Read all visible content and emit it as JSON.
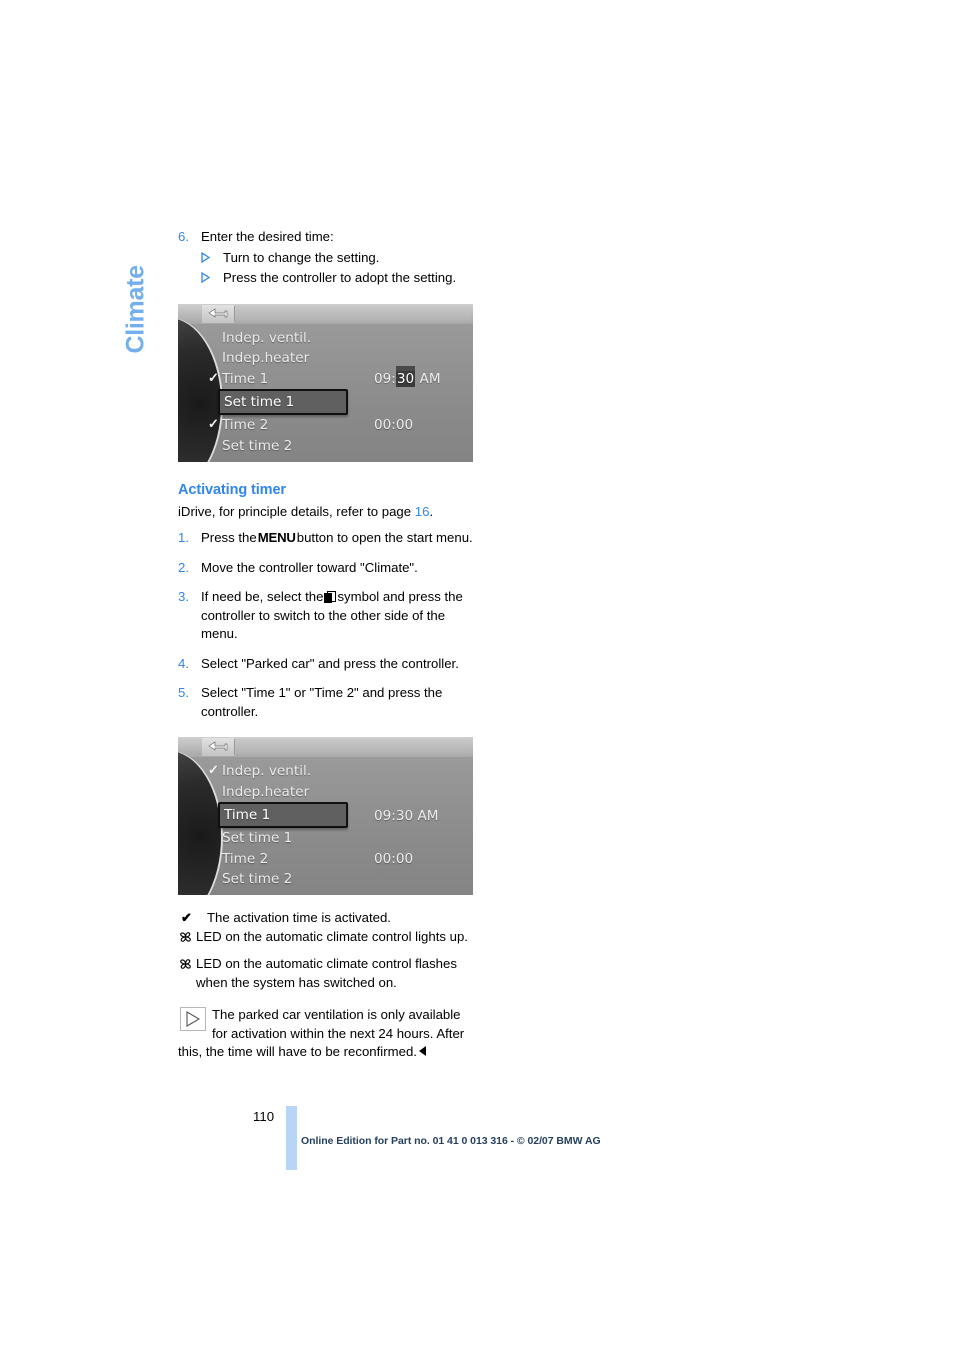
{
  "chapter_tab": {
    "label": "Climate"
  },
  "steps_top": {
    "number": "6.",
    "text": "Enter the desired time:",
    "substeps": [
      {
        "marker": "triangle-outline",
        "text": "Turn to change the setting."
      },
      {
        "marker": "triangle-outline",
        "text": "Press the controller to adopt the setting."
      }
    ]
  },
  "figure_1": {
    "back_icon": "back-arrow-icon",
    "figure_id": "SW-EHC249444",
    "rows": [
      {
        "check": "",
        "label": "Indep. ventil.",
        "value": ""
      },
      {
        "check": "",
        "label": "Indep.heater",
        "value": ""
      },
      {
        "check": "✓",
        "label": "Time 1",
        "value_prefix": "09:",
        "value_highlight": "30",
        "value_suffix": " AM",
        "selected": false
      },
      {
        "check": "",
        "label": "Set time 1",
        "value": "",
        "selected": true
      },
      {
        "check": "✓",
        "label": "Time 2",
        "value": "00:00"
      },
      {
        "check": "",
        "label": "Set time 2",
        "value": ""
      }
    ]
  },
  "section": {
    "heading": "Activating timer",
    "intro_prefix": "iDrive, for principle details, refer to page ",
    "intro_link": "16",
    "intro_suffix": ".",
    "steps": [
      {
        "num": "1.",
        "parts": [
          "Press the",
          "MENU",
          "button to open the start menu."
        ],
        "kind": "menukey"
      },
      {
        "num": "2.",
        "text": "Move the controller toward \"Climate\"."
      },
      {
        "num": "3.",
        "parts": [
          "If need be, select the",
          "split-screen-symbol",
          "symbol and press the controller to switch to the other side of the menu."
        ],
        "kind": "symbol"
      },
      {
        "num": "4.",
        "text": "Select \"Parked car\" and press the controller."
      },
      {
        "num": "5.",
        "text": "Select \"Time 1\" or \"Time 2\" and press the controller."
      }
    ]
  },
  "figure_2": {
    "back_icon": "back-arrow-icon",
    "figure_id": "SW-EHC249444",
    "rows": [
      {
        "check": "✓",
        "label": "Indep. ventil.",
        "value": ""
      },
      {
        "check": "",
        "label": "Indep.heater",
        "value": ""
      },
      {
        "check": "",
        "label": "Time 1",
        "value": "09:30  AM",
        "selected": true
      },
      {
        "check": "",
        "label": "Set time 1",
        "value": ""
      },
      {
        "check": "",
        "label": "Time 2",
        "value": "00:00"
      },
      {
        "check": "",
        "label": "Set time 2",
        "value": ""
      }
    ]
  },
  "results": [
    {
      "marker": "check-icon",
      "text": "The activation time is activated."
    },
    {
      "marker": "fan-icon",
      "text": "LED on the automatic climate control lights up."
    },
    {
      "marker": "fan-icon",
      "text": "LED on the automatic climate control flashes when the system has switched on."
    }
  ],
  "note": {
    "icon": "note-triangle-icon",
    "text": "The parked car ventilation is only available for activation within the next 24 hours. After this, the time will have to be reconfirmed.",
    "end_marker": "end-of-note-icon"
  },
  "footer": {
    "page_number": "110",
    "legal": "Online Edition for Part no. 01 41 0 013 316 - © 02/07 BMW AG"
  },
  "colors": {
    "accent_blue": "#2e86ef",
    "tab_blue": "#73aeee",
    "footer_bar": "#b9d5f5"
  }
}
